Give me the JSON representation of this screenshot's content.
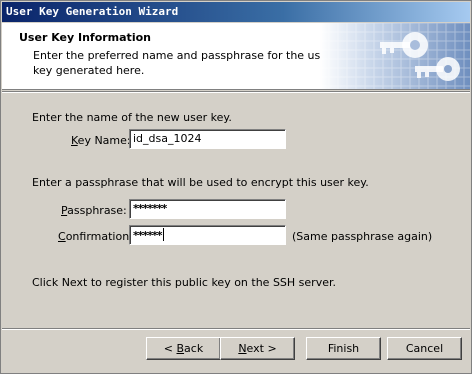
{
  "window": {
    "title": "User Key Generation Wizard"
  },
  "header": {
    "title": "User Key Information",
    "description_line1": "Enter the preferred name and passphrase for the user",
    "description_line2": "key generated here."
  },
  "body": {
    "name_prompt": "Enter the name of the new user key.",
    "key_name": {
      "label_accel": "K",
      "label_rest": "ey Name:",
      "value": "id_dsa_1024"
    },
    "passphrase_prompt": "Enter a passphrase that will be used to encrypt this user key.",
    "passphrase": {
      "label_accel": "P",
      "label_rest": "assphrase:",
      "value": "*******"
    },
    "confirmation": {
      "label_accel": "C",
      "label_rest": "onfirmation:",
      "value": "******",
      "hint": "(Same passphrase again)"
    },
    "register_note": "Click Next to register this public key on the SSH server."
  },
  "buttons": {
    "back": {
      "prefix": "< ",
      "accel": "B",
      "rest": "ack"
    },
    "next": {
      "accel": "N",
      "rest": "ext >"
    },
    "finish": "Finish",
    "cancel": "Cancel"
  },
  "icons": {
    "header_art": "keys-icon"
  }
}
